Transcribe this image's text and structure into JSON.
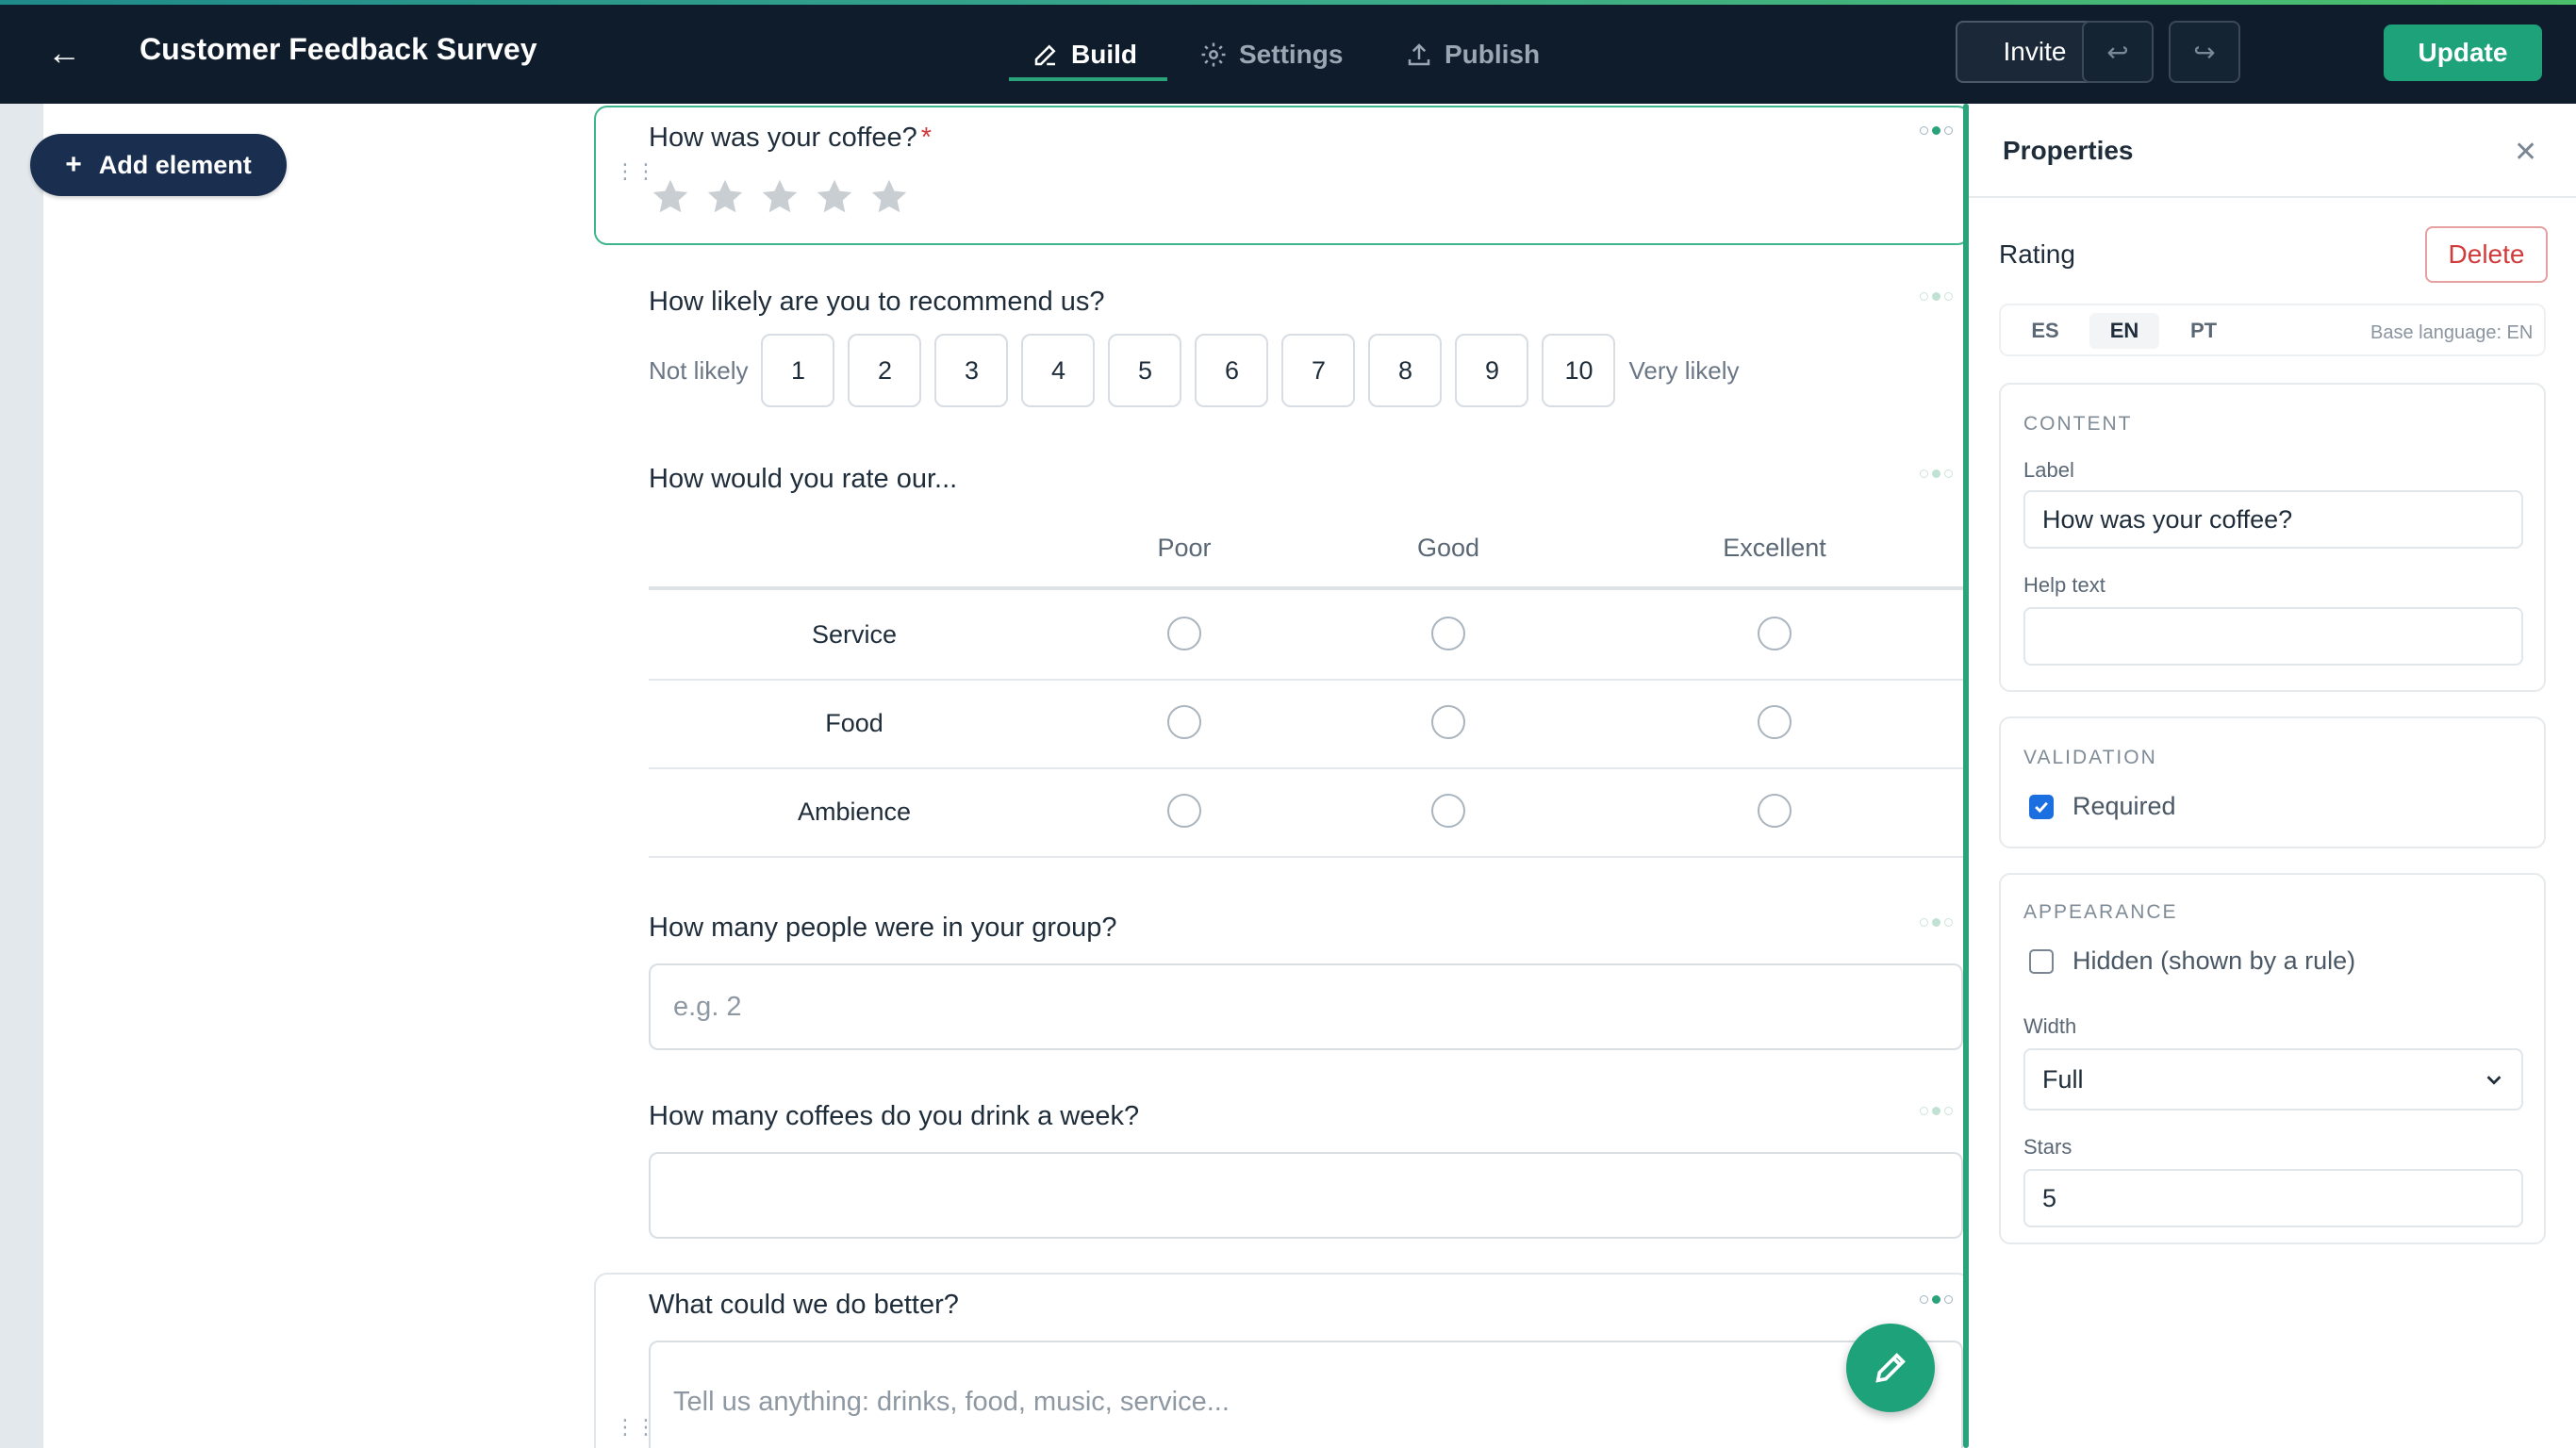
{
  "header": {
    "title": "Customer Feedback Survey",
    "tabs": [
      {
        "label": "Build",
        "icon": "pencil-icon",
        "active": true
      },
      {
        "label": "Settings",
        "icon": "gear-icon",
        "active": false
      },
      {
        "label": "Publish",
        "icon": "upload-icon",
        "active": false
      }
    ],
    "invite_label": "Invite",
    "update_label": "Update"
  },
  "sidebar": {
    "add_element_label": "Add element"
  },
  "form": {
    "q1": {
      "label": "How was your coffee?",
      "required_mark": "*",
      "stars": 5
    },
    "q2": {
      "label": "How likely are you to recommend us?",
      "min_label": "Not likely",
      "max_label": "Very likely",
      "options": [
        "1",
        "2",
        "3",
        "4",
        "5",
        "6",
        "7",
        "8",
        "9",
        "10"
      ]
    },
    "q3": {
      "label": "How would you rate our...",
      "columns": [
        "Poor",
        "Good",
        "Excellent"
      ],
      "rows": [
        "Service",
        "Food",
        "Ambience"
      ]
    },
    "q4": {
      "label": "How many people were in your group?",
      "placeholder": "e.g. 2"
    },
    "q5": {
      "label": "How many coffees do you drink a week?",
      "placeholder": ""
    },
    "q6": {
      "label": "What could we do better?",
      "placeholder": "Tell us anything: drinks, food, music, service..."
    }
  },
  "properties": {
    "title": "Properties",
    "element_type": "Rating",
    "delete_label": "Delete",
    "languages": [
      "ES",
      "EN",
      "PT"
    ],
    "active_language": "EN",
    "base_language": "Base language: EN",
    "content": {
      "title": "CONTENT",
      "label_label": "Label",
      "label_value": "How was your coffee?",
      "help_label": "Help text",
      "help_value": ""
    },
    "validation": {
      "title": "VALIDATION",
      "required_label": "Required",
      "required_checked": true
    },
    "appearance": {
      "title": "APPEARANCE",
      "hidden_label": "Hidden (shown by a rule)",
      "hidden_checked": false,
      "width_label": "Width",
      "width_value": "Full",
      "stars_label": "Stars",
      "stars_value": "5"
    }
  },
  "colors": {
    "accent": "#1ea27a",
    "topbar": "#0f1c2c",
    "delete": "#d23b3b",
    "checkbox": "#1b6fe0"
  }
}
